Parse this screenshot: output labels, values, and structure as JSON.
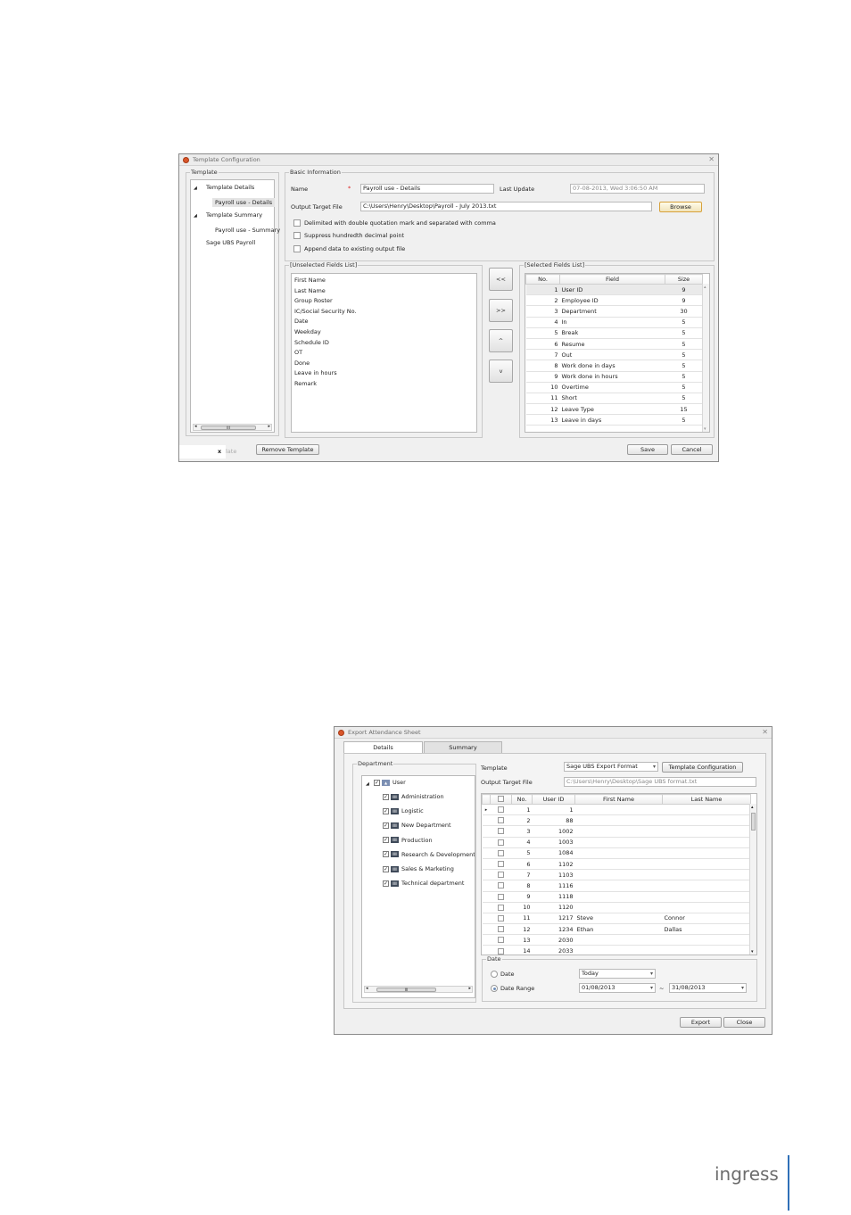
{
  "template_config": {
    "title": "Template Configuration",
    "template_group": "Template",
    "tree": [
      {
        "label": "Template Details",
        "children": [
          "Payroll use - Details"
        ]
      },
      {
        "label": "Template Summary",
        "children": [
          "Payroll use - Summary"
        ]
      },
      {
        "label": "Sage UBS Payroll",
        "children": []
      }
    ],
    "basic_info": "Basic Information",
    "name_label": "Name",
    "required_mark": "*",
    "name_value": "Payroll use - Details",
    "last_update_label": "Last Update",
    "last_update_value": "07-08-2013, Wed 3:06:50 AM",
    "output_label": "Output Target File",
    "output_value": "C:\\Users\\Henry\\Desktop\\Payroll - July 2013.txt",
    "browse": "Browse",
    "options": [
      "Delimited with double quotation mark and separated with comma",
      "Suppress hundredth decimal point",
      "Append data to existing output file"
    ],
    "unselected_label": "[Unselected Fields List]",
    "unselected": [
      "First Name",
      "Last Name",
      "Group Roster",
      "IC/Social Security No.",
      "Date",
      "Weekday",
      "Schedule ID",
      "OT",
      "Done",
      "Leave in hours",
      "Remark"
    ],
    "move_buttons": [
      "<<",
      ">>",
      "^",
      "v"
    ],
    "selected_label": "[Selected Fields List]",
    "selected_headers": [
      "No.",
      "Field",
      "Size"
    ],
    "selected_rows": [
      [
        "1",
        "User ID",
        "9"
      ],
      [
        "2",
        "Employee ID",
        "9"
      ],
      [
        "3",
        "Department",
        "30"
      ],
      [
        "4",
        "In",
        "5"
      ],
      [
        "5",
        "Break",
        "5"
      ],
      [
        "6",
        "Resume",
        "5"
      ],
      [
        "7",
        "Out",
        "5"
      ],
      [
        "8",
        "Work done in days",
        "5"
      ],
      [
        "9",
        "Work done in hours",
        "5"
      ],
      [
        "10",
        "Overtime",
        "5"
      ],
      [
        "11",
        "Short",
        "5"
      ],
      [
        "12",
        "Leave Type",
        "15"
      ],
      [
        "13",
        "Leave in days",
        "5"
      ]
    ],
    "cut_button_x": "x",
    "cut_button_text": "late",
    "remove_template": "Remove Template",
    "save": "Save",
    "cancel": "Cancel",
    "scroll_thumb_glyph": "III"
  },
  "export_sheet": {
    "title": "Export Attendance Sheet",
    "tabs": [
      "Details",
      "Summary"
    ],
    "department_label": "Department",
    "root": "User",
    "departments": [
      "Administration",
      "Logistic",
      "New Department",
      "Production",
      "Research & Development",
      "Sales & Marketing",
      "Technical department"
    ],
    "dept_icon_text": "IIIII",
    "template_label": "Template",
    "template_value": "Sage UBS Export Format",
    "template_config_button": "Template Configuration",
    "output_label": "Output Target File",
    "output_value": "C:\\Users\\Henry\\Desktop\\Sage UBS format.txt",
    "grid_headers": [
      "No.",
      "User ID",
      "First Name",
      "Last Name"
    ],
    "grid_rows": [
      [
        "1",
        "1",
        "",
        ""
      ],
      [
        "2",
        "88",
        "",
        ""
      ],
      [
        "3",
        "1002",
        "",
        ""
      ],
      [
        "4",
        "1003",
        "",
        ""
      ],
      [
        "5",
        "1084",
        "",
        ""
      ],
      [
        "6",
        "1102",
        "",
        ""
      ],
      [
        "7",
        "1103",
        "",
        ""
      ],
      [
        "8",
        "1116",
        "",
        ""
      ],
      [
        "9",
        "1118",
        "",
        ""
      ],
      [
        "10",
        "1120",
        "",
        ""
      ],
      [
        "11",
        "1217",
        "Steve",
        "Connor"
      ],
      [
        "12",
        "1234",
        "Ethan",
        "Dallas"
      ],
      [
        "13",
        "2030",
        "",
        ""
      ],
      [
        "14",
        "2033",
        "",
        ""
      ]
    ],
    "date_group": "Date",
    "date_option": "Date",
    "date_value": "Today",
    "range_option": "Date Range",
    "range_from": "01/08/2013",
    "range_sep": "~",
    "range_to": "31/08/2013",
    "export": "Export",
    "close": "Close",
    "scroll_thumb_glyph": "III"
  },
  "brand": "ingress",
  "colors": {
    "accent": "#3070b8",
    "app_icon": "#d9562a",
    "brand_text": "#6d6d6d"
  }
}
